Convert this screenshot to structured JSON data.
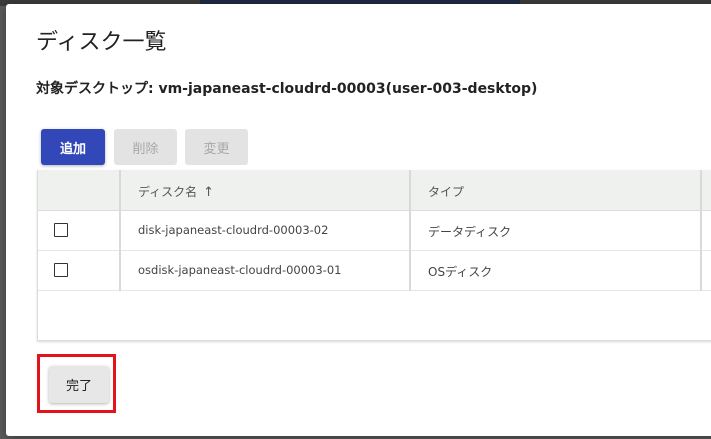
{
  "dialog": {
    "title": "ディスク一覧",
    "target_label": "対象デスクトップ: vm-japaneast-cloudrd-00003(user-003-desktop)"
  },
  "toolbar": {
    "add_label": "追加",
    "delete_label": "削除",
    "change_label": "変更"
  },
  "table": {
    "columns": [
      "ディスク名",
      "タイプ"
    ],
    "sort_indicator": "↑",
    "rows": [
      {
        "name": "disk-japaneast-cloudrd-00003-02",
        "type": "データディスク",
        "checked": false
      },
      {
        "name": "osdisk-japaneast-cloudrd-00003-01",
        "type": "OSディスク",
        "checked": false
      }
    ]
  },
  "footer": {
    "done_label": "完了"
  },
  "colors": {
    "primary_button": "#3348b8",
    "highlight_outline": "#e3121b"
  }
}
